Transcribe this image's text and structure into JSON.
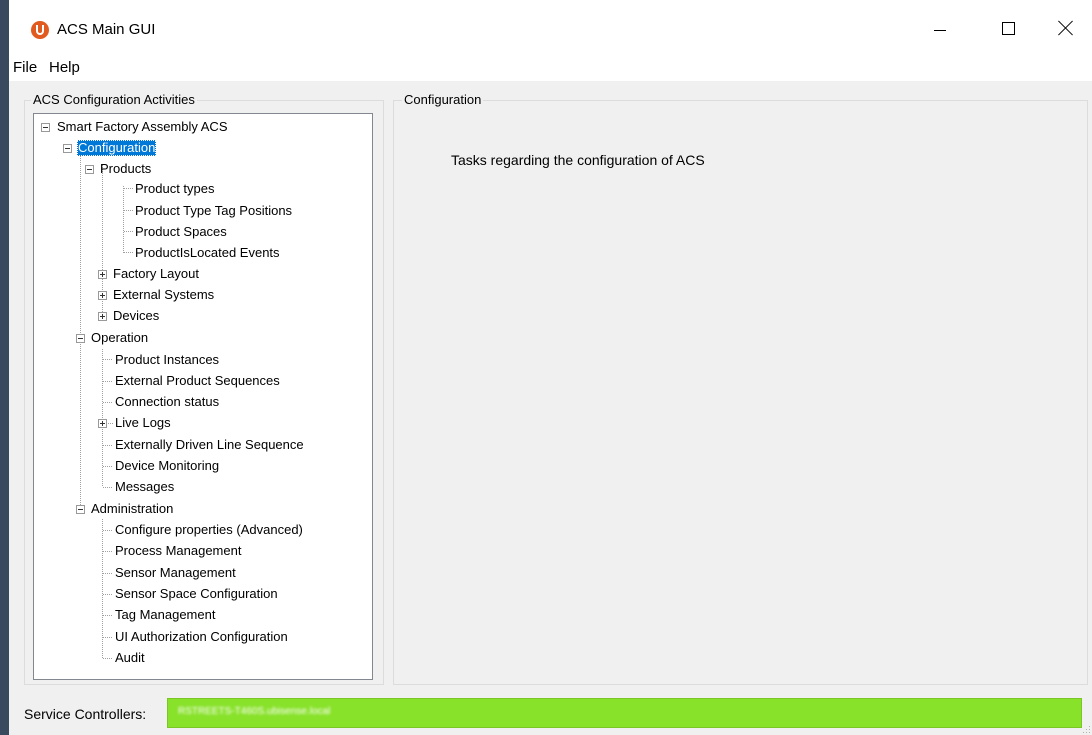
{
  "window": {
    "title": "ACS Main GUI"
  },
  "menu": {
    "file": "File",
    "help": "Help"
  },
  "left_panel": {
    "title": "ACS Configuration Activities",
    "tree": {
      "root": "Smart Factory Assembly ACS",
      "configuration": "Configuration",
      "products": "Products",
      "product_types": "Product types",
      "product_type_tag_positions": "Product Type Tag Positions",
      "product_spaces": "Product Spaces",
      "product_is_located_events": "ProductIsLocated Events",
      "factory_layout": "Factory Layout",
      "external_systems": "External Systems",
      "devices": "Devices",
      "operation": "Operation",
      "product_instances": "Product Instances",
      "external_product_sequences": "External Product Sequences",
      "connection_status": "Connection status",
      "live_logs": "Live Logs",
      "externally_driven_line_sequence": "Externally Driven Line Sequence",
      "device_monitoring": "Device Monitoring",
      "messages": "Messages",
      "administration": "Administration",
      "configure_properties": "Configure properties (Advanced)",
      "process_management": "Process Management",
      "sensor_management": "Sensor Management",
      "sensor_space_configuration": "Sensor Space Configuration",
      "tag_management": "Tag Management",
      "ui_authorization_configuration": "UI Authorization Configuration",
      "audit": "Audit"
    },
    "selected": "Configuration"
  },
  "right_panel": {
    "title": "Configuration",
    "description": "Tasks regarding the configuration of ACS"
  },
  "status_bar": {
    "label": "Service Controllers:",
    "value": "RSTREETS-T460S.ubisense.local",
    "color": "#88e22a"
  },
  "colors": {
    "selection": "#0078d7",
    "app_icon": "#e15a1f"
  }
}
